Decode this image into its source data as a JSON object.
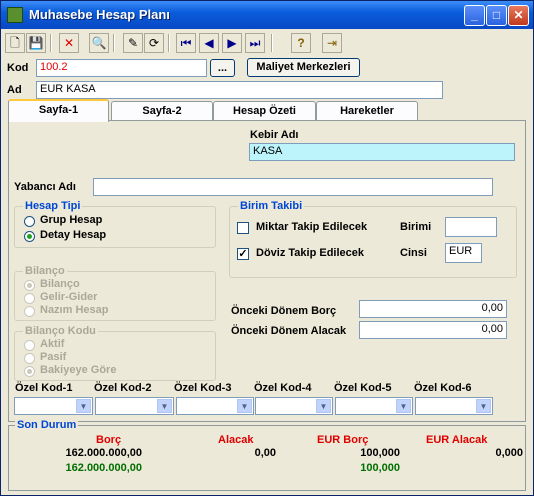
{
  "window": {
    "title": "Muhasebe Hesap Planı",
    "min": "_",
    "max": "□",
    "close": "✕"
  },
  "toolbar": {
    "new": "🗋",
    "save": "💾",
    "delete": "✕",
    "find": "🔍",
    "edit": "✎",
    "refresh": "⟳",
    "first": "⏮",
    "prev": "◀",
    "next": "▶",
    "last": "⏭",
    "help": "?",
    "exit": "⇥"
  },
  "form": {
    "kod_label": "Kod",
    "kod_value": "100.2",
    "dots_label": "...",
    "maliyet_label": "Maliyet Merkezleri",
    "ad_label": "Ad",
    "ad_value": "EUR KASA"
  },
  "tabs": [
    "Sayfa-1",
    "Sayfa-2",
    "Hesap Özeti",
    "Hareketler"
  ],
  "page1": {
    "kebir_label": "Kebir Adı",
    "kebir_value": "KASA",
    "yabanci_label": "Yabancı Adı",
    "yabanci_value": "",
    "hesap_tipi": {
      "title": "Hesap Tipi",
      "options": [
        "Grup Hesap",
        "Detay Hesap"
      ],
      "selected": "Detay Hesap"
    },
    "bilanco": {
      "title": "Bilanço",
      "options": [
        "Bilanço",
        "Gelir-Gider",
        "Nazım Hesap"
      ],
      "selected": "Bilanço"
    },
    "bilanco_kodu": {
      "title": "Bilanço Kodu",
      "options": [
        "Aktif",
        "Pasif",
        "Bakiyeye Göre"
      ],
      "selected": "Bakiyeye Göre"
    },
    "birim_takibi": {
      "title": "Birim Takibi",
      "miktar_label": "Miktar Takip Edilecek",
      "miktar_checked": false,
      "birimi_label": "Birimi",
      "birimi_value": "",
      "doviz_label": "Döviz Takip Edilecek",
      "doviz_checked": true,
      "cinsi_label": "Cinsi",
      "cinsi_value": "EUR"
    },
    "onceki_borc_label": "Önceki Dönem Borç",
    "onceki_borc_value": "0,00",
    "onceki_alacak_label": "Önceki Dönem Alacak",
    "onceki_alacak_value": "0,00",
    "ozel_kod_labels": [
      "Özel Kod-1",
      "Özel Kod-2",
      "Özel Kod-3",
      "Özel Kod-4",
      "Özel Kod-5",
      "Özel Kod-6"
    ]
  },
  "son_durum": {
    "title": "Son Durum",
    "borc_label": "Borç",
    "alacak_label": "Alacak",
    "eur_borc_label": "EUR Borç",
    "eur_alacak_label": "EUR Alacak",
    "borc_1": "162.000.000,00",
    "alacak_1": "0,00",
    "eur_borc_1": "100,000",
    "eur_alacak_1": "0,000",
    "borc_2": "162.000.000,00",
    "eur_borc_2": "100,000"
  }
}
